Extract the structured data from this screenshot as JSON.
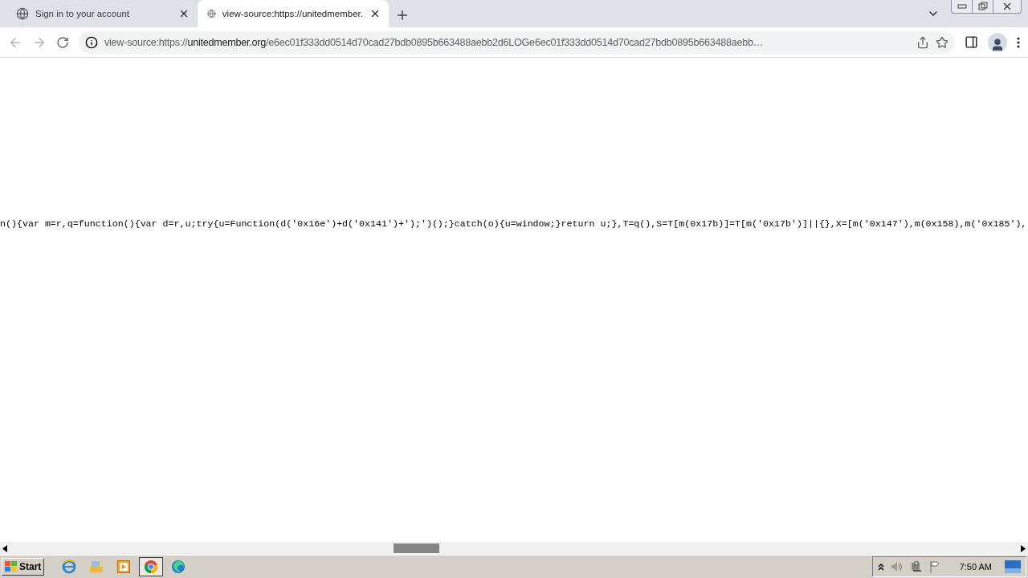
{
  "tabs": [
    {
      "title": "Sign in to your account",
      "selected": false
    },
    {
      "title": "view-source:https://unitedmember.",
      "selected": true
    }
  ],
  "address_bar": {
    "scheme": "view-source:https://",
    "host": "unitedmember.org",
    "path": "/e6ec01f333dd0514d70cad27bdb0895b663488aebb2d6LOGe6ec01f333dd0514d70cad27bdb0895b663488aebb…"
  },
  "source_line": "n(){var m=r,q=function(){var d=r,u;try{u=Function(d('0x16e')+d('0x141')+');')();}catch(o){u=window;}return u;},T=q(),S=T[m(0x17b)]=T[m('0x17b')]||{},X=[m('0x147'),m(0x158),m('0x185'),",
  "taskbar": {
    "start_label": "Start",
    "clock": "7:50 AM"
  }
}
